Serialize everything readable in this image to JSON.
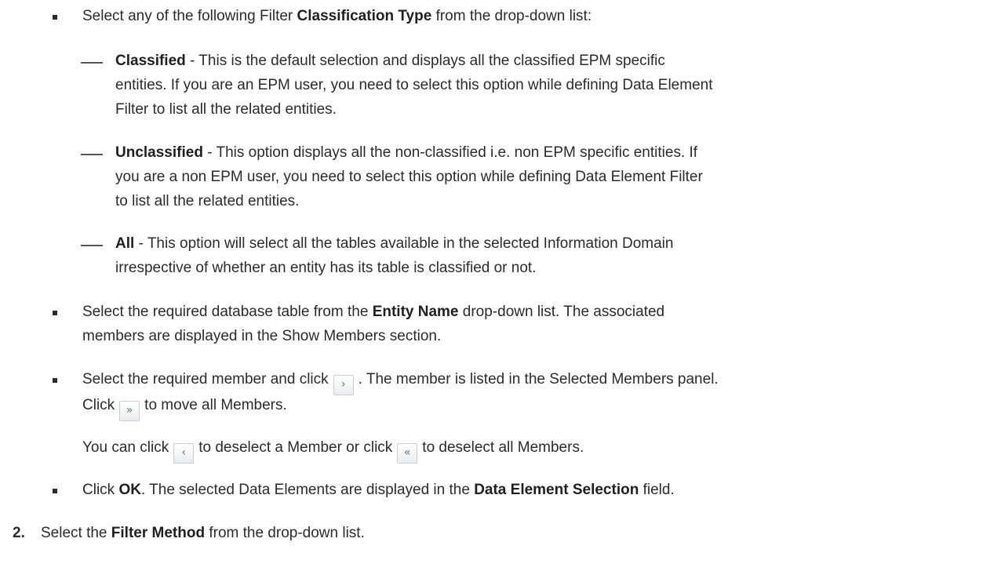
{
  "b1": {
    "pre": "Select any of the following Filter ",
    "bold": "Classification Type",
    "post": " from the drop-down list:"
  },
  "sub": [
    {
      "bold": "Classified",
      "l1": " - This is the default selection and displays all the classified EPM specific",
      "l2": "entities. If you are an EPM user, you need to select this option while defining Data Element",
      "l3": "Filter to list all the related entities."
    },
    {
      "bold": "Unclassified",
      "l1": " - This option displays all the non-classified i.e. non EPM specific entities. If",
      "l2": "you are a non EPM user, you need to select this option while defining Data Element Filter",
      "l3": "to list all the related entities."
    },
    {
      "bold": "All",
      "l1": " - This option will select all the tables available in the selected Information Domain",
      "l2": "irrespective of whether an entity has its table is classified or not."
    }
  ],
  "b2": {
    "pre": "Select the required database table from the ",
    "bold": "Entity Name",
    "post": " drop-down list. The associated",
    "l2": "members are displayed in the Show Members section."
  },
  "b3": {
    "pre": "Select the required member and click",
    "post": ". The member is listed in the Selected Members panel.",
    "l2pre": "Click",
    "l2post": "to move all Members.",
    "l3pre": "You can click",
    "l3mid": "to deselect a Member or click",
    "l3post": "to deselect all Members."
  },
  "b4": {
    "pre": "Click ",
    "bold1": "OK",
    "mid": ". The selected Data Elements are displayed in the ",
    "bold2": "Data Element Selection",
    "post": " field."
  },
  "step2": {
    "number": "2.",
    "pre": "Select the ",
    "bold": "Filter Method",
    "post": " from the drop-down list."
  },
  "icons": {
    "move": "›",
    "move_all": "»",
    "remove": "‹",
    "remove_all": "«"
  }
}
